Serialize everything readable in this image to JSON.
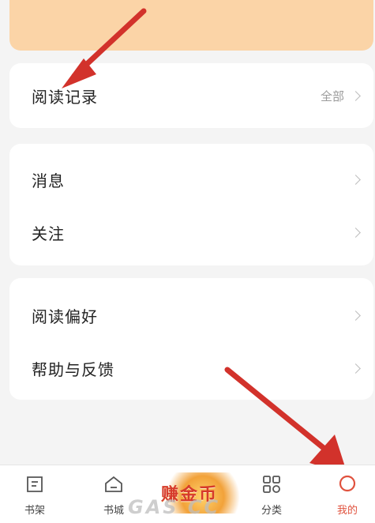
{
  "sections": {
    "history": {
      "label": "阅读记录",
      "right": "全部"
    },
    "group1": [
      {
        "label": "消息"
      },
      {
        "label": "关注"
      }
    ],
    "group2": [
      {
        "label": "阅读偏好"
      },
      {
        "label": "帮助与反馈"
      }
    ]
  },
  "tabbar": {
    "items": [
      {
        "label": "书架",
        "icon": "bookshelf-icon"
      },
      {
        "label": "书城",
        "icon": "home-icon"
      },
      {
        "label": "分类",
        "icon": "grid-icon"
      },
      {
        "label": "我的",
        "icon": "profile-icon"
      }
    ],
    "promo_text": "赚金币"
  },
  "watermark": "GAS CC",
  "colors": {
    "banner": "#fbd4a7",
    "arrow": "#d2322b"
  }
}
